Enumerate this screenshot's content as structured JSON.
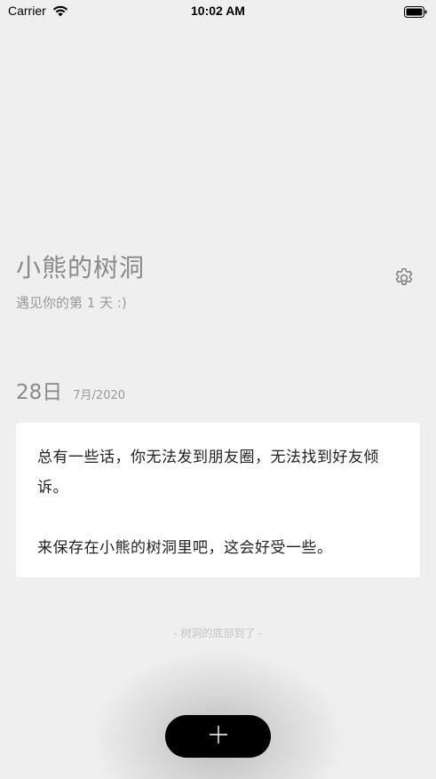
{
  "status_bar": {
    "carrier": "Carrier",
    "time": "10:02 AM"
  },
  "header": {
    "title": "小熊的树洞",
    "subtitle": "遇见你的第 1 天 :)"
  },
  "entry": {
    "day": "28日",
    "month_year": "7月/2020",
    "paragraph_1": "总有一些话，你无法发到朋友圈，无法找到好友倾诉。",
    "paragraph_2": "来保存在小熊的树洞里吧，这会好受一些。"
  },
  "footer": {
    "end_text": "- 树洞的底部到了 -"
  },
  "icons": {
    "settings": "gear-icon",
    "add": "plus-icon",
    "wifi": "wifi-icon",
    "battery": "battery-icon"
  },
  "colors": {
    "background": "#efefef",
    "card": "#ffffff",
    "fab": "#000000"
  }
}
